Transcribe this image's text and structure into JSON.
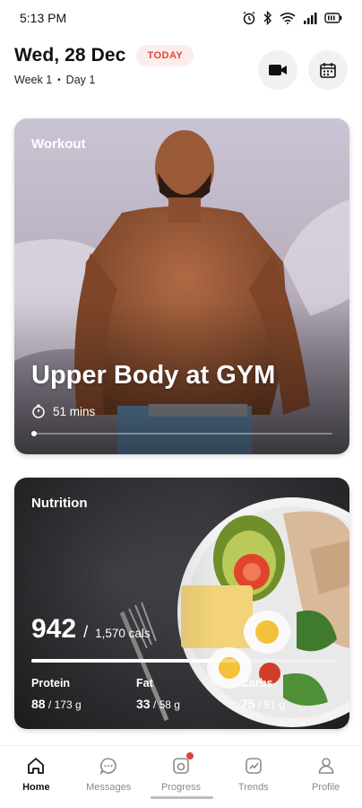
{
  "status_bar": {
    "time": "5:13 PM"
  },
  "header": {
    "date": "Wed, 28 Dec",
    "badge": "TODAY",
    "week": "Week 1",
    "day": "Day 1"
  },
  "workout": {
    "label": "Workout",
    "title": "Upper Body at GYM",
    "duration": "51 mins",
    "progress": 0.02
  },
  "nutrition": {
    "label": "Nutrition",
    "calories": "942",
    "calories_total": "1,570 cals",
    "progress": 0.6,
    "macros": [
      {
        "name": "Protein",
        "value": "88",
        "target": "/ 173 g"
      },
      {
        "name": "Fat",
        "value": "33",
        "target": "/ 58 g"
      },
      {
        "name": "Carbs",
        "value": "75",
        "target": "/ 91 g"
      }
    ]
  },
  "nav": [
    {
      "label": "Home",
      "icon": "home-icon",
      "active": true
    },
    {
      "label": "Messages",
      "icon": "chat-icon",
      "active": false
    },
    {
      "label": "Progress",
      "icon": "progress-icon",
      "active": false
    },
    {
      "label": "Trends",
      "icon": "trends-icon",
      "active": false
    },
    {
      "label": "Profile",
      "icon": "profile-icon",
      "active": false
    }
  ],
  "colors": {
    "accent_red": "#e0443a",
    "badge_bg": "#fdecec"
  }
}
